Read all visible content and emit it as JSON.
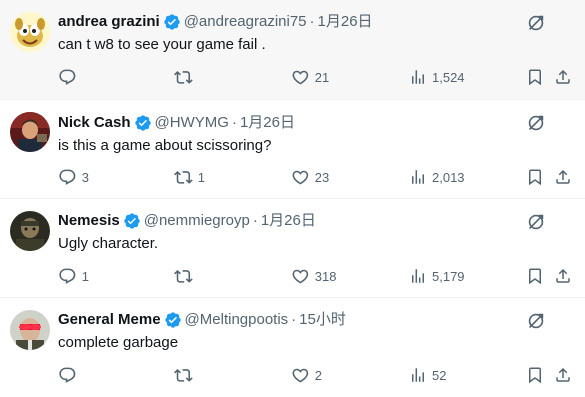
{
  "replies": [
    {
      "name": "andrea grazini",
      "handle": "@andreagrazini75",
      "dot": "·",
      "time": "1月26日",
      "text": "can t w8 to see your game fail .",
      "replies": "",
      "retweets": "",
      "likes": "21",
      "views": "1,524"
    },
    {
      "name": "Nick Cash",
      "handle": "@HWYMG",
      "dot": "·",
      "time": "1月26日",
      "text": "is this a game about scissoring?",
      "replies": "3",
      "retweets": "1",
      "likes": "23",
      "views": "2,013"
    },
    {
      "name": "Nemesis",
      "handle": "@nemmiegroyp",
      "dot": "·",
      "time": "1月26日",
      "text": "Ugly character.",
      "replies": "1",
      "retweets": "",
      "likes": "318",
      "views": "5,179"
    },
    {
      "name": "General Meme",
      "handle": "@Meltingpootis",
      "dot": "·",
      "time": "15小时",
      "text": "complete garbage",
      "replies": "",
      "retweets": "",
      "likes": "2",
      "views": "52"
    }
  ],
  "colors": {
    "verified": "#1d9bf0",
    "muted": "#536471",
    "text": "#0f1419",
    "highlight_bg": "#f7f7f7"
  },
  "icons": {
    "reply": "speech-bubble-icon",
    "retweet": "retweet-arrows-icon",
    "like": "heart-icon",
    "views": "bar-chart-icon",
    "bookmark": "bookmark-icon",
    "share": "share-upload-icon",
    "more": "grok-slash-icon",
    "verified": "verified-badge-icon"
  }
}
